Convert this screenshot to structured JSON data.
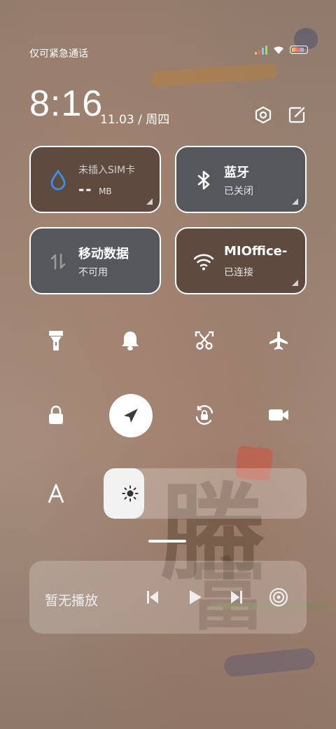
{
  "status": {
    "carrier_text": "仅可紧急通话"
  },
  "header": {
    "time": "8:16",
    "date": "11.03 / 周四",
    "icons": [
      "settings-hex-icon",
      "edit-icon"
    ]
  },
  "tiles": {
    "sim": {
      "label": "未插入SIM卡",
      "value": "--",
      "unit": "MB",
      "icon": "water-drop-icon"
    },
    "bluetooth": {
      "label": "蓝牙",
      "status": "已关闭",
      "icon": "bluetooth-icon"
    },
    "mobile_data": {
      "label": "移动数据",
      "status": "不可用",
      "icon": "data-arrows-icon"
    },
    "wifi": {
      "label": "MIOffice-",
      "status": "已连接",
      "icon": "wifi-icon"
    }
  },
  "toggles": [
    {
      "name": "flashlight",
      "icon": "flashlight-icon",
      "active": false
    },
    {
      "name": "bell",
      "icon": "bell-icon",
      "active": false
    },
    {
      "name": "screenshot",
      "icon": "scissors-frame-icon",
      "active": false
    },
    {
      "name": "airplane",
      "icon": "airplane-icon",
      "active": false
    },
    {
      "name": "lock",
      "icon": "lock-icon",
      "active": false
    },
    {
      "name": "location",
      "icon": "navigation-arrow-icon",
      "active": true
    },
    {
      "name": "rotation-lock",
      "icon": "rotation-lock-icon",
      "active": false
    },
    {
      "name": "video",
      "icon": "video-camera-icon",
      "active": false
    },
    {
      "name": "font",
      "icon": "font-a-icon",
      "active": false
    }
  ],
  "brightness": {
    "level": 0.2,
    "icon": "sun-icon"
  },
  "media": {
    "label": "暂无播放",
    "controls": [
      "previous-icon",
      "play-icon",
      "next-icon",
      "cast-icon"
    ]
  },
  "colors": {
    "tile_brown": "#5e4a3f",
    "tile_gray": "#55575b",
    "accent_blue": "#3d8ee6",
    "tile_border": "#ffffff"
  }
}
